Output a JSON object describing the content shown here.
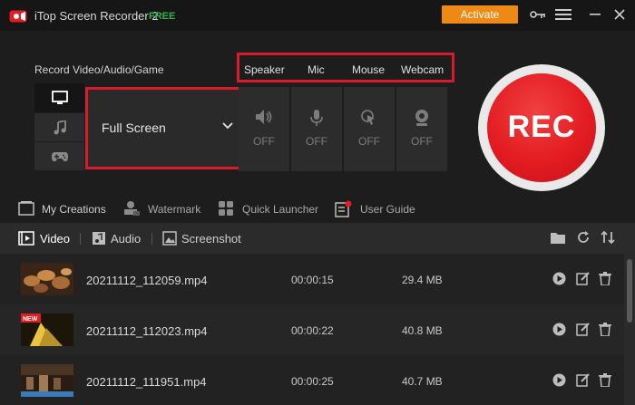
{
  "app": {
    "title": "iTop Screen Recorder 2",
    "badge": "FREE",
    "activate_label": "Activate"
  },
  "record": {
    "section_label": "Record Video/Audio/Game",
    "mode_value": "Full Screen",
    "sources": [
      {
        "label": "Speaker",
        "state": "OFF",
        "icon": "speaker-icon"
      },
      {
        "label": "Mic",
        "state": "OFF",
        "icon": "mic-icon"
      },
      {
        "label": "Mouse",
        "state": "OFF",
        "icon": "mouse-icon"
      },
      {
        "label": "Webcam",
        "state": "OFF",
        "icon": "webcam-icon"
      }
    ],
    "rec_label": "REC"
  },
  "toolbar": {
    "my_creations": "My Creations",
    "watermark": "Watermark",
    "quick_launcher": "Quick Launcher",
    "user_guide": "User Guide"
  },
  "tabs": {
    "video": "Video",
    "audio": "Audio",
    "screenshot": "Screenshot"
  },
  "recordings": [
    {
      "name": "20211112_112059.mp4",
      "duration": "00:00:15",
      "size": "29.4 MB"
    },
    {
      "name": "20211112_112023.mp4",
      "duration": "00:00:22",
      "size": "40.8 MB",
      "badge": "NEW"
    },
    {
      "name": "20211112_111951.mp4",
      "duration": "00:00:25",
      "size": "40.7 MB"
    }
  ],
  "colors": {
    "accent_red": "#e31c22",
    "activate_orange": "#ee8a13",
    "free_green": "#2fb14a",
    "highlight_red": "#d91a2a"
  }
}
